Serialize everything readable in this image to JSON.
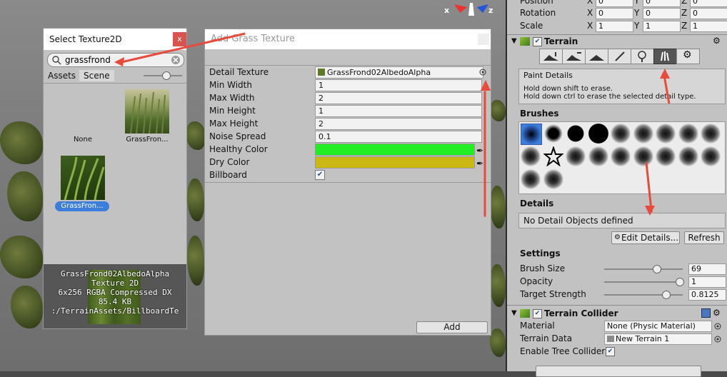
{
  "gizmo": {
    "x_label": "x",
    "z_label": "z"
  },
  "select_window": {
    "title": "Select Texture2D",
    "close": "x",
    "search_value": "grassfrond",
    "tabs": [
      "Assets",
      "Scene"
    ],
    "items": [
      {
        "label": "None"
      },
      {
        "label": "GrassFron..."
      },
      {
        "label": "GrassFron..."
      }
    ],
    "preview_lines": [
      "GrassFrond02AlbedoAlpha",
      "Texture 2D",
      "6x256  RGBA Compressed DX",
      "85.4 KB",
      ":/TerrainAssets/BillboardTe"
    ]
  },
  "add_grass": {
    "title": "Add Grass Texture",
    "rows": [
      {
        "label": "Detail Texture",
        "value": "GrassFrond02AlbedoAlpha"
      },
      {
        "label": "Min Width",
        "value": "1"
      },
      {
        "label": "Max Width",
        "value": "2"
      },
      {
        "label": "Min Height",
        "value": "1"
      },
      {
        "label": "Max Height",
        "value": "2"
      },
      {
        "label": "Noise Spread",
        "value": "0.1"
      },
      {
        "label": "Healthy Color",
        "value": ""
      },
      {
        "label": "Dry Color",
        "value": ""
      },
      {
        "label": "Billboard",
        "value": ""
      }
    ],
    "healthy_color": "#22ee22",
    "dry_color": "#ccb814",
    "add_button": "Add"
  },
  "inspector": {
    "transform": {
      "position_label": "Position",
      "rotation_label": "Rotation",
      "rot": [
        "0",
        "0",
        "0"
      ],
      "scale_label": "Scale",
      "scale": [
        "1",
        "1",
        "1"
      ],
      "axes": [
        "X",
        "Y",
        "Z"
      ],
      "pos": [
        "0",
        "0",
        "0"
      ]
    },
    "terrain_title": "Terrain",
    "paint_details": "Paint Details",
    "hint1": "Hold down shift to erase.",
    "hint2": "Hold down ctrl to erase the selected detail type.",
    "brushes_title": "Brushes",
    "details_title": "Details",
    "no_details": "No Detail Objects defined",
    "edit_details": "Edit Details...",
    "refresh": "Refresh",
    "settings_title": "Settings",
    "settings": [
      {
        "label": "Brush Size",
        "value": "69",
        "level": 0.69
      },
      {
        "label": "Opacity",
        "value": "1",
        "level": 1.0
      },
      {
        "label": "Target Strength",
        "value": "0.8125",
        "level": 0.8125
      }
    ],
    "collider_title": "Terrain Collider",
    "material_label": "Material",
    "material_value": "None (Physic Material)",
    "terrain_data_label": "Terrain Data",
    "terrain_data_value": "New Terrain 1",
    "tree_collider_label": "Enable Tree Collider"
  }
}
